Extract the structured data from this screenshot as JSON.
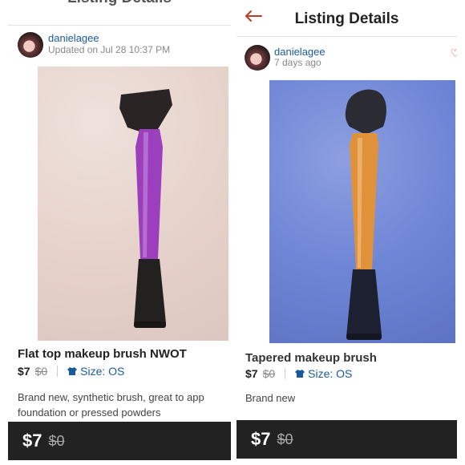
{
  "left": {
    "header_title": "Listing Details",
    "username": "danielagee",
    "updated": "Updated on Jul 28 10:37 PM",
    "item_title": "Flat top makeup brush NWOT",
    "price": "$7",
    "original_price": "$0",
    "size": "Size: OS",
    "description_lines": [
      "Brand new, synthetic brush, great to app",
      "foundation or pressed powders"
    ],
    "footer_price": "$7",
    "footer_original_price": "$0"
  },
  "right": {
    "header_title": "Listing Details",
    "username": "danielagee",
    "updated": "7 days ago",
    "item_title": "Tapered makeup brush",
    "price": "$7",
    "original_price": "$0",
    "size": "Size: OS",
    "description": "Brand new",
    "footer_price": "$7",
    "footer_original_price": "$0"
  },
  "icons": [
    "back-arrow-icon",
    "heart-icon",
    "shirt-icon"
  ],
  "colors": {
    "link": "#1a5a9a",
    "accent": "#c0392b",
    "footer_bg": "#222222"
  }
}
